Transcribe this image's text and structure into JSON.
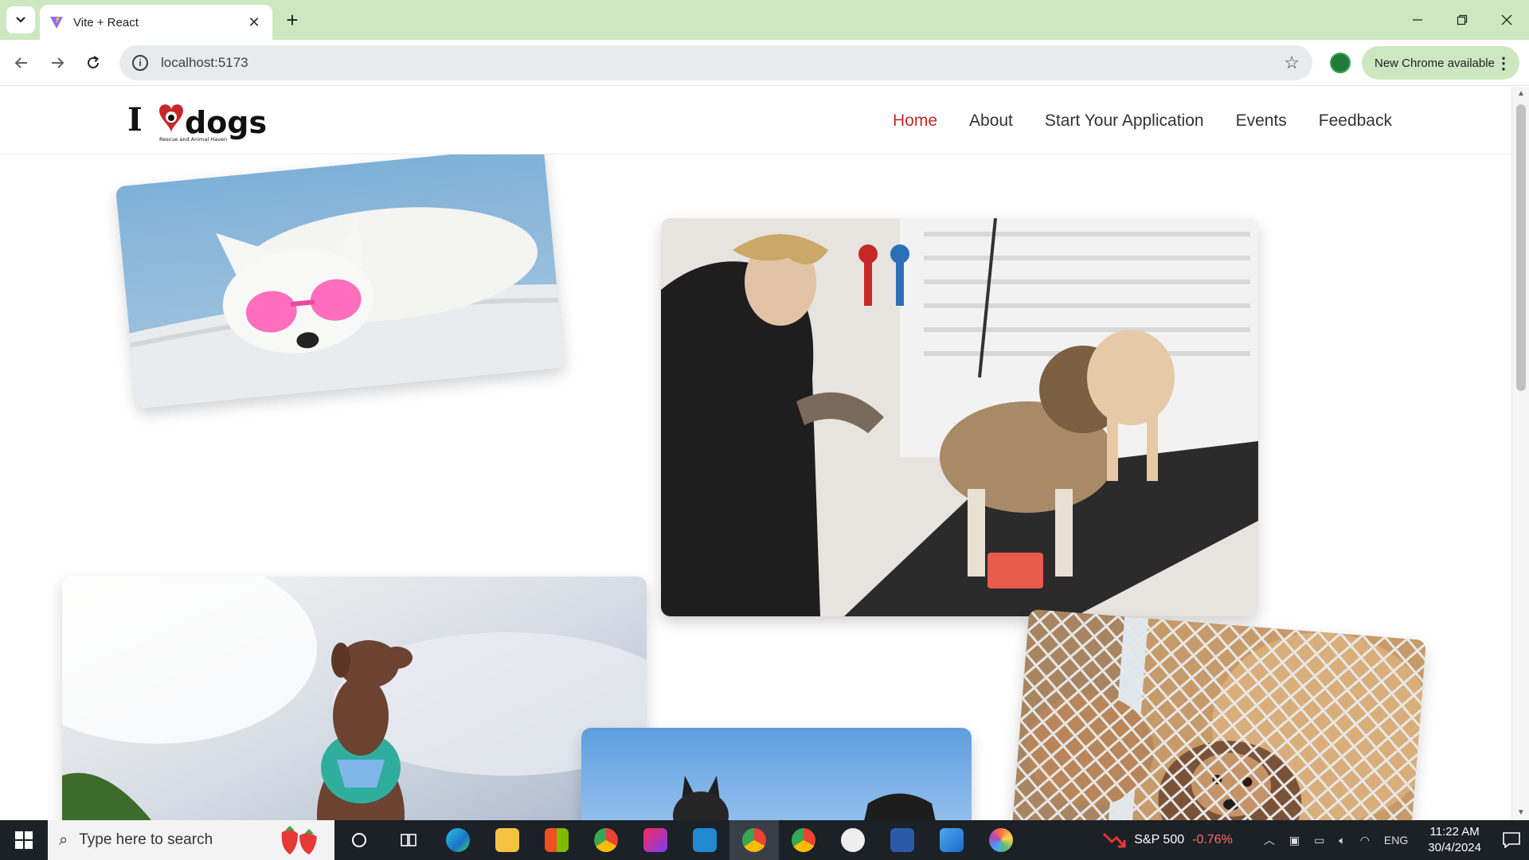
{
  "browser": {
    "tab_title": "Vite + React",
    "url": "localhost:5173",
    "update_label": "New Chrome available"
  },
  "site": {
    "logo_text_i": "I",
    "logo_text_dogs": "dogs",
    "logo_tagline": "Rescue and Animal Haven",
    "nav": [
      {
        "label": "Home",
        "active": true
      },
      {
        "label": "About",
        "active": false
      },
      {
        "label": "Start Your Application",
        "active": false
      },
      {
        "label": "Events",
        "active": false
      },
      {
        "label": "Feedback",
        "active": false
      }
    ],
    "photos": [
      {
        "subject": "White dog wearing pink heart sunglasses"
      },
      {
        "subject": "Groomer trimming a small dog"
      },
      {
        "subject": "Brown dog with bandana against cloudy sky"
      },
      {
        "subject": "Dogs under blue sky"
      },
      {
        "subject": "Puppies behind chain-link fence"
      }
    ]
  },
  "taskbar": {
    "search_placeholder": "Type here to search",
    "stock_name": "S&P 500",
    "stock_change": "-0.76%",
    "language": "ENG",
    "time": "11:22 AM",
    "date": "30/4/2024"
  },
  "colors": {
    "accent_active_nav": "#c62828",
    "chrome_frame": "#cde8c0",
    "taskbar": "#1c2027"
  }
}
